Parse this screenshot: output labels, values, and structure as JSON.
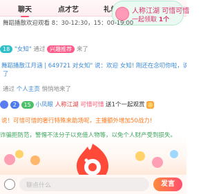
{
  "tabs": [
    "聊天",
    "点才艺",
    "礼单"
  ],
  "promo": {
    "line1_a": "人称江湖",
    "line1_b": "可惜可惜",
    "line2_a": "一起领取",
    "line2_b": "1个"
  },
  "messages": {
    "m1": "舞蹈播散欢迎观看 8：30-12:30，15：00-19:00",
    "m2_badge": "18",
    "m2_user": "\"女知\"",
    "m2_via": "通过",
    "m2_tag": "兴趣推荐",
    "m2_end": "来了",
    "m3": "舞蹈播散江月涵 | 649721 对女知\" 说：欢迎 女知! 刚还在念叨你啦，说着",
    "m3b": "了",
    "m4_pre": "通过",
    "m4_link": "个人主页",
    "m4_end": "悄悄地来了",
    "m5_badge_a": "2",
    "m5_badge_b": "15",
    "m5_user": "小凤眼",
    "m5_name": "人称江湖",
    "m5_gift": "可惜可惜",
    "m5_end": "送1个一起观赏",
    "m6": "说！可惜可惜的奢行特殊来助场呢，主播额外增加50战力!",
    "notice": "诈骗拒防范，警惕不法分子以充值人物等，以免个人财产受到损失。"
  },
  "input": {
    "placeholder": "聊点什么"
  },
  "send_label": "发言",
  "icons": [
    "emoji-icon",
    "mascot-icon",
    "gift-icon"
  ]
}
